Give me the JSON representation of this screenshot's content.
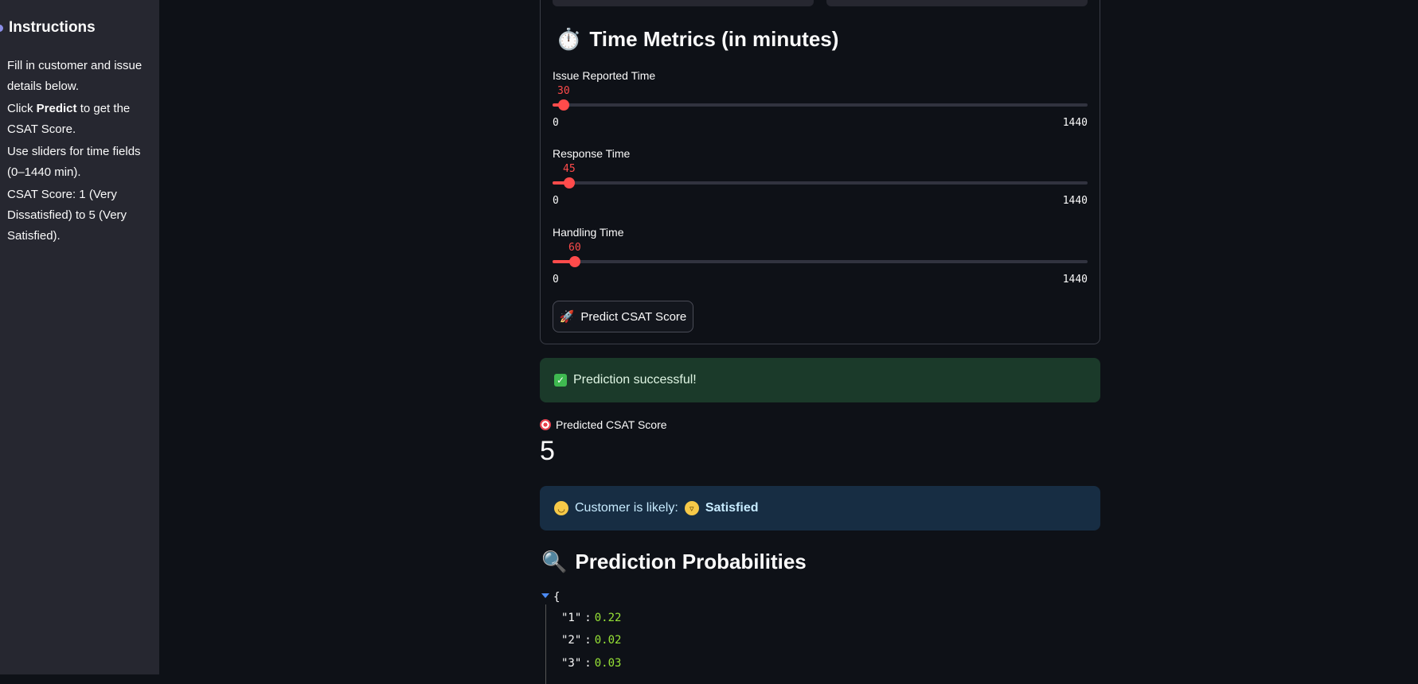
{
  "sidebar": {
    "title": "Instructions",
    "items": [
      {
        "text": "Fill in customer and issue details below."
      },
      {
        "pre": "Click ",
        "bold": "Predict",
        "post": " to get the CSAT Score."
      },
      {
        "text": "Use sliders for time fields (0–1440 min)."
      },
      {
        "text": "CSAT Score: 1 (Very Dissatisfied) to 5 (Very Satisfied)."
      }
    ]
  },
  "time_metrics": {
    "heading_icon": "⏱️",
    "heading": "Time Metrics (in minutes)",
    "sliders": [
      {
        "label": "Issue Reported Time",
        "value": "30",
        "min": "0",
        "max": "1440"
      },
      {
        "label": "Response Time",
        "value": "45",
        "min": "0",
        "max": "1440"
      },
      {
        "label": "Handling Time",
        "value": "60",
        "min": "0",
        "max": "1440"
      }
    ],
    "predict_button": {
      "icon": "🚀",
      "label": "Predict CSAT Score"
    }
  },
  "success_alert": {
    "text": "Prediction successful!"
  },
  "metric": {
    "label": "Predicted CSAT Score",
    "value": "5"
  },
  "info_alert": {
    "prefix": "Customer is likely:",
    "value": "Satisfied"
  },
  "probabilities": {
    "heading_icon": "🔍",
    "heading": "Prediction Probabilities",
    "open_brace": "{",
    "entries": [
      {
        "key": "\"1\"",
        "value": "0.22"
      },
      {
        "key": "\"2\"",
        "value": "0.02"
      },
      {
        "key": "\"3\"",
        "value": "0.03"
      }
    ]
  },
  "colors": {
    "accent": "#ff4b4b",
    "success_bg": "#1b3a2a",
    "info_bg": "#172d43",
    "json_value": "#97e336"
  }
}
